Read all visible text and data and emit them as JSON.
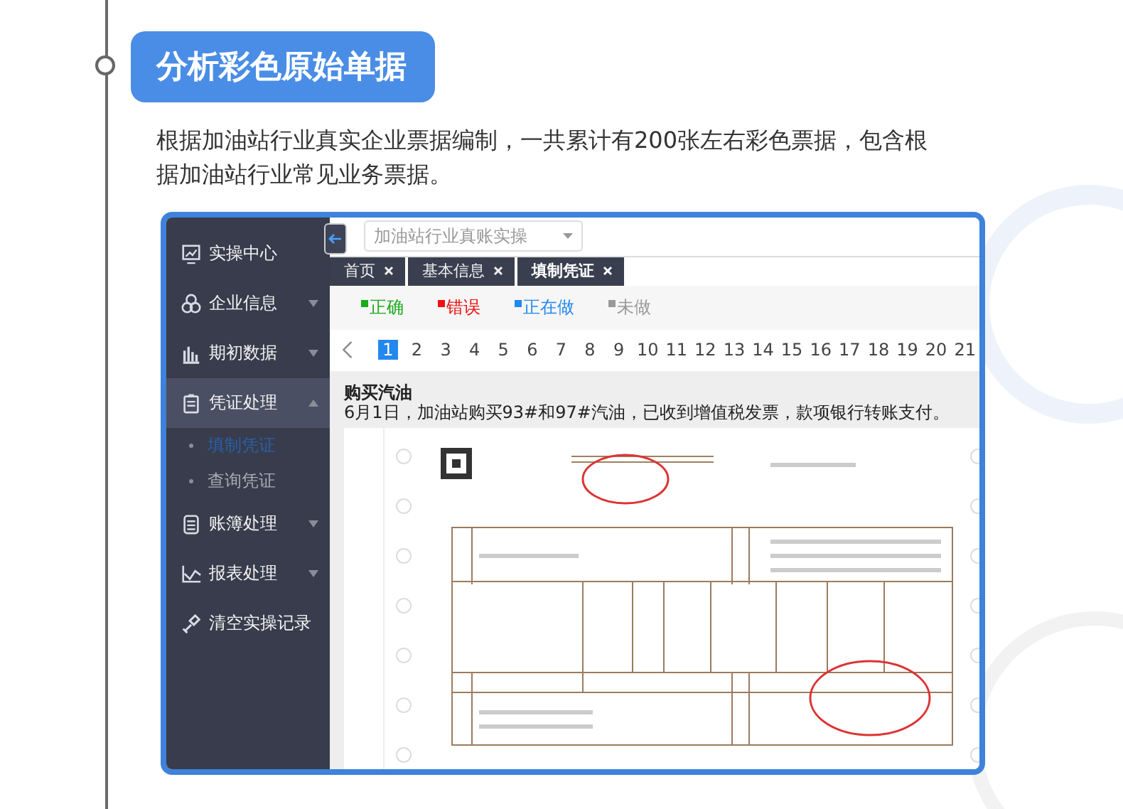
{
  "heading": "分析彩色原始单据",
  "description": "根据加油站行业真实企业票据编制，一共累计有200张左右彩色票据，包含根据加油站行业常见业务票据。",
  "app": {
    "sidebar": {
      "items": [
        {
          "label": "实操中心",
          "kind": "link",
          "selected": false
        },
        {
          "label": "企业信息",
          "kind": "group",
          "expanded": false,
          "selected": false
        },
        {
          "label": "期初数据",
          "kind": "group",
          "expanded": false,
          "selected": false
        },
        {
          "label": "凭证处理",
          "kind": "group",
          "expanded": true,
          "selected": true,
          "children": [
            {
              "label": "填制凭证",
              "selected": true
            },
            {
              "label": "查询凭证",
              "selected": false
            }
          ]
        },
        {
          "label": "账簿处理",
          "kind": "group",
          "expanded": false,
          "selected": false
        },
        {
          "label": "报表处理",
          "kind": "group",
          "expanded": false,
          "selected": false
        },
        {
          "label": "清空实操记录",
          "kind": "link",
          "selected": false
        }
      ]
    },
    "course_select": {
      "value": "加油站行业真账实操"
    },
    "tabs": [
      {
        "label": "首页",
        "selected": false
      },
      {
        "label": "基本信息",
        "selected": false
      },
      {
        "label": "填制凭证",
        "selected": true
      }
    ],
    "legend": [
      {
        "label": "正确",
        "color": "#1aaa1a"
      },
      {
        "label": "错误",
        "color": "#ee1111"
      },
      {
        "label": "正在做",
        "color": "#2288ee"
      },
      {
        "label": "未做",
        "color": "#999999"
      }
    ],
    "pages": [
      {
        "label": "1",
        "selected": true
      },
      {
        "label": "2",
        "selected": false
      },
      {
        "label": "3",
        "selected": false
      },
      {
        "label": "4",
        "selected": false
      },
      {
        "label": "5",
        "selected": false
      },
      {
        "label": "6",
        "selected": false
      },
      {
        "label": "7",
        "selected": false
      },
      {
        "label": "8",
        "selected": false
      },
      {
        "label": "9",
        "selected": false
      },
      {
        "label": "10",
        "selected": false
      },
      {
        "label": "11",
        "selected": false
      },
      {
        "label": "12",
        "selected": false
      },
      {
        "label": "13",
        "selected": false
      },
      {
        "label": "14",
        "selected": false
      },
      {
        "label": "15",
        "selected": false
      },
      {
        "label": "16",
        "selected": false
      },
      {
        "label": "17",
        "selected": false
      },
      {
        "label": "18",
        "selected": false
      },
      {
        "label": "19",
        "selected": false
      },
      {
        "label": "20",
        "selected": false
      },
      {
        "label": "21",
        "selected": false
      }
    ],
    "voucher": {
      "title": "购买汽油",
      "text": "6月1日，加油站购买93#和97#汽油，已收到增值税发票，款项银行转账支付。"
    }
  }
}
